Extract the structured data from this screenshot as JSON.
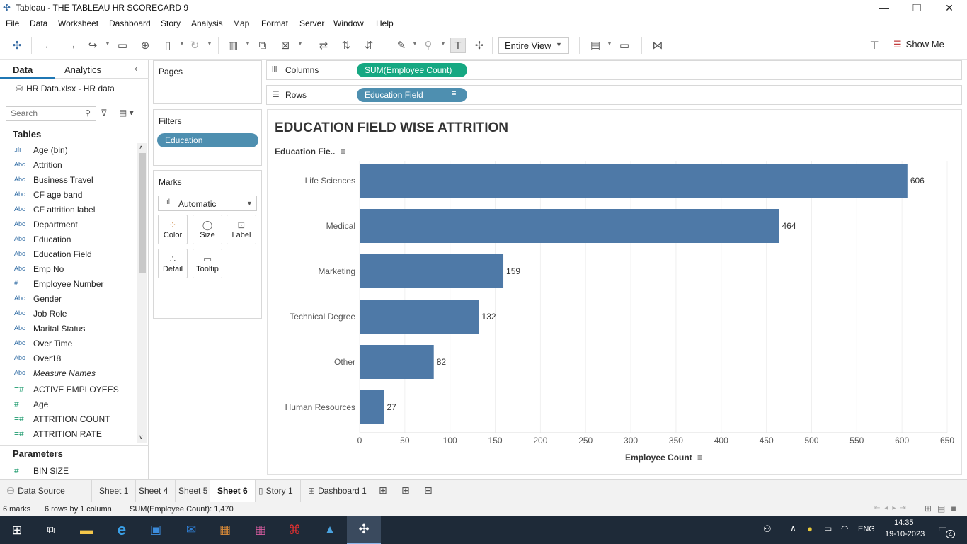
{
  "window": {
    "title": "Tableau - THE TABLEAU HR SCORECARD 9",
    "min": "—",
    "max": "❐",
    "close": "✕"
  },
  "menu": [
    "File",
    "Data",
    "Worksheet",
    "Dashboard",
    "Story",
    "Analysis",
    "Map",
    "Format",
    "Server",
    "Window",
    "Help"
  ],
  "toolbar": {
    "view_select": "Entire View",
    "show_me": "Show Me"
  },
  "left": {
    "tab_data": "Data",
    "tab_analytics": "Analytics",
    "datasource": "HR Data.xlsx - HR data",
    "search_placeholder": "Search",
    "tables_header": "Tables",
    "dimensions": [
      {
        "icon": "bin",
        "name": "Age (bin)"
      },
      {
        "icon": "Abc",
        "name": "Attrition"
      },
      {
        "icon": "Abc",
        "name": "Business Travel"
      },
      {
        "icon": "Abc",
        "name": "CF age band"
      },
      {
        "icon": "Abc",
        "name": "CF attrition label"
      },
      {
        "icon": "Abc",
        "name": "Department"
      },
      {
        "icon": "Abc",
        "name": "Education"
      },
      {
        "icon": "Abc",
        "name": "Education Field"
      },
      {
        "icon": "Abc",
        "name": "Emp No"
      },
      {
        "icon": "#",
        "name": "Employee Number"
      },
      {
        "icon": "Abc",
        "name": "Gender"
      },
      {
        "icon": "Abc",
        "name": "Job Role"
      },
      {
        "icon": "Abc",
        "name": "Marital Status"
      },
      {
        "icon": "Abc",
        "name": "Over Time"
      },
      {
        "icon": "Abc",
        "name": "Over18"
      },
      {
        "icon": "Abc",
        "name": "Measure Names"
      }
    ],
    "measures": [
      {
        "icon": "=#",
        "name": "ACTIVE EMPLOYEES"
      },
      {
        "icon": "#",
        "name": "Age"
      },
      {
        "icon": "=#",
        "name": "ATTRITION COUNT"
      },
      {
        "icon": "=#",
        "name": "ATTRITION RATE"
      }
    ],
    "parameters_header": "Parameters",
    "parameters": [
      {
        "icon": "#",
        "name": "BIN SIZE"
      }
    ]
  },
  "cards": {
    "pages": "Pages",
    "filters": "Filters",
    "filter_pill": "Education",
    "marks": "Marks",
    "mark_type": "Automatic",
    "mark_buttons": [
      "Color",
      "Size",
      "Label",
      "Detail",
      "Tooltip"
    ]
  },
  "shelves": {
    "columns_label": "Columns",
    "columns_pill": "SUM(Employee Count)",
    "rows_label": "Rows",
    "rows_pill": "Education Field"
  },
  "viz": {
    "title": "EDUCATION FIELD WISE ATTRITION",
    "row_header": "Education Fie..",
    "bar_color": "#4e79a7"
  },
  "chart_data": {
    "type": "bar",
    "orientation": "horizontal",
    "title": "EDUCATION FIELD WISE ATTRITION",
    "xlabel": "Employee Count",
    "ylabel": "Education Fie..",
    "categories": [
      "Life Sciences",
      "Medical",
      "Marketing",
      "Technical Degree",
      "Other",
      "Human Resources"
    ],
    "values": [
      606,
      464,
      159,
      132,
      82,
      27
    ],
    "xlim": [
      0,
      650
    ],
    "xticks": [
      0,
      50,
      100,
      150,
      200,
      250,
      300,
      350,
      400,
      450,
      500,
      550,
      600,
      650
    ],
    "grid": true
  },
  "sheet_tabs": [
    "Data Source",
    "Sheet 1",
    "Sheet 4",
    "Sheet 5",
    "Sheet 6",
    "Story 1",
    "Dashboard 1"
  ],
  "active_tab": "Sheet 6",
  "status": {
    "marks": "6 marks",
    "rows": "6 rows by 1 column",
    "sum": "SUM(Employee Count): 1,470"
  },
  "taskbar": {
    "lang": "ENG",
    "time": "14:35",
    "date": "19-10-2023",
    "notif": "4"
  }
}
